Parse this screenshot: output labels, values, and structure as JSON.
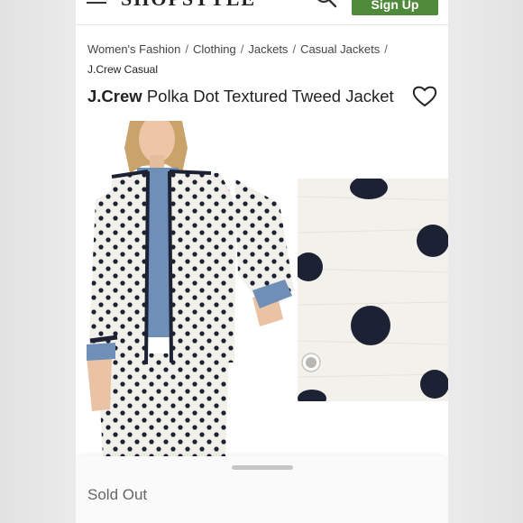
{
  "header": {
    "logo_text": "SHOPSTYLE",
    "signup_label": "Sign Up"
  },
  "breadcrumb": {
    "items": [
      "Women's Fashion",
      "Clothing",
      "Jackets",
      "Casual Jackets"
    ],
    "separator": "/",
    "current": "J.Crew Casual"
  },
  "product": {
    "brand": "J.Crew",
    "name": "Polka Dot Textured Tweed Jacket"
  },
  "status": {
    "sold_out": "Sold Out"
  },
  "colors": {
    "accent_green": "#4f8a3a",
    "dot_navy": "#1c2233",
    "tweed_white": "#f3f1ec"
  },
  "icons": [
    "menu-icon",
    "search-icon",
    "heart-icon"
  ]
}
